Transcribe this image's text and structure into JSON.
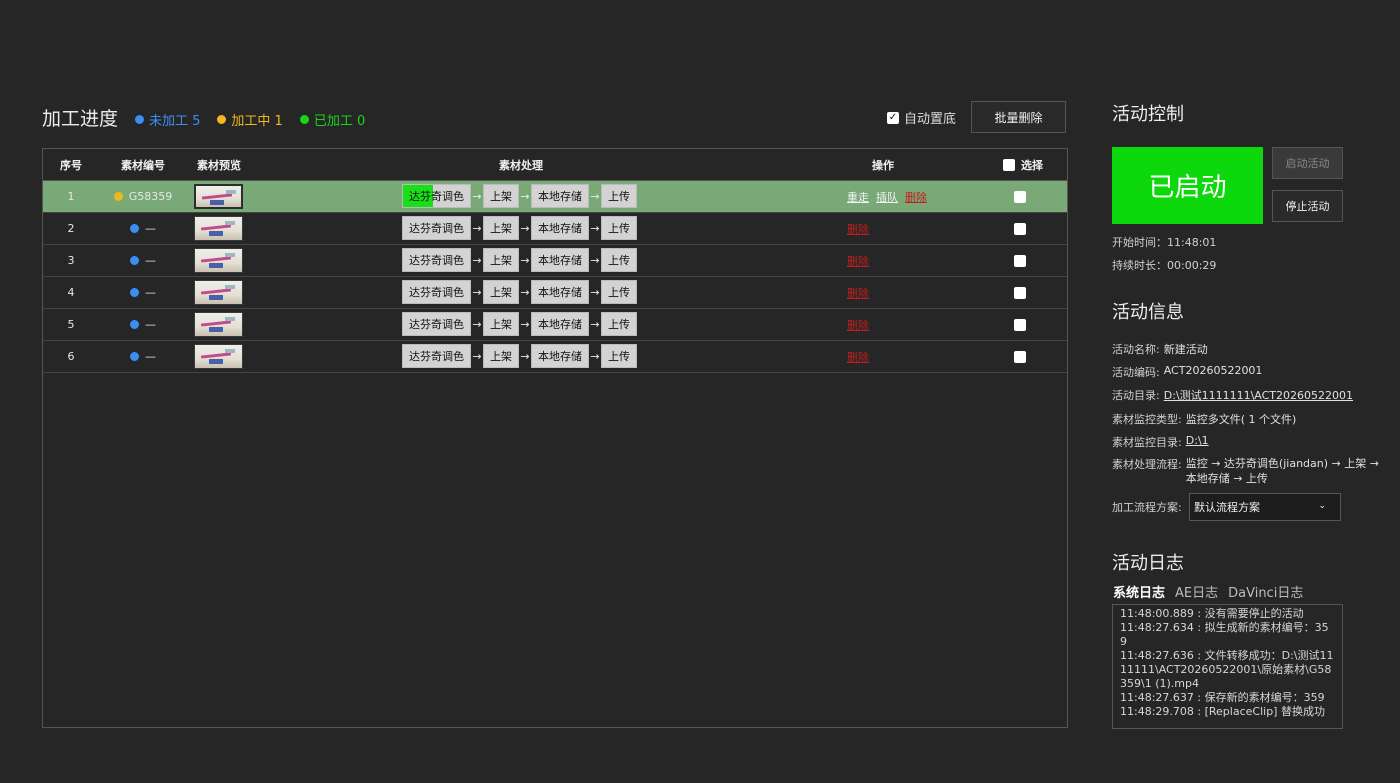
{
  "progress": {
    "title": "加工进度",
    "legend": [
      {
        "label": "未加工 5",
        "color": "#3d8ef0"
      },
      {
        "label": "加工中 1",
        "color": "#f0b81a"
      },
      {
        "label": "已加工 0",
        "color": "#1bd31b"
      }
    ],
    "auto_bottom_label": "自动置底",
    "auto_bottom_checked": true,
    "batch_delete_label": "批量删除"
  },
  "table": {
    "headers": {
      "index": "序号",
      "code": "素材编号",
      "preview": "素材预览",
      "process": "素材处理",
      "ops": "操作",
      "select": "选择"
    },
    "rows": [
      {
        "index": "1",
        "code": "G58359",
        "status_color": "#f0b81a",
        "active": true,
        "steps": [
          "达芬奇调色",
          "上架",
          "本地存储",
          "上传"
        ],
        "first_step_progress": 0.45,
        "ops": {
          "retry": "重走",
          "insert": "插队",
          "delete": "删除"
        }
      },
      {
        "index": "2",
        "code": "—",
        "status_color": "#3d8ef0",
        "active": false,
        "steps": [
          "达芬奇调色",
          "上架",
          "本地存储",
          "上传"
        ],
        "first_step_progress": 0,
        "ops": {
          "delete": "删除"
        }
      },
      {
        "index": "3",
        "code": "—",
        "status_color": "#3d8ef0",
        "active": false,
        "steps": [
          "达芬奇调色",
          "上架",
          "本地存储",
          "上传"
        ],
        "first_step_progress": 0,
        "ops": {
          "delete": "删除"
        }
      },
      {
        "index": "4",
        "code": "—",
        "status_color": "#3d8ef0",
        "active": false,
        "steps": [
          "达芬奇调色",
          "上架",
          "本地存储",
          "上传"
        ],
        "first_step_progress": 0,
        "ops": {
          "delete": "删除"
        }
      },
      {
        "index": "5",
        "code": "—",
        "status_color": "#3d8ef0",
        "active": false,
        "steps": [
          "达芬奇调色",
          "上架",
          "本地存储",
          "上传"
        ],
        "first_step_progress": 0,
        "ops": {
          "delete": "删除"
        }
      },
      {
        "index": "6",
        "code": "—",
        "status_color": "#3d8ef0",
        "active": false,
        "steps": [
          "达芬奇调色",
          "上架",
          "本地存储",
          "上传"
        ],
        "first_step_progress": 0,
        "ops": {
          "delete": "删除"
        }
      }
    ]
  },
  "control": {
    "title": "活动控制",
    "status_label": "已启动",
    "start_button": "启动活动",
    "stop_button": "停止活动",
    "start_time": "开始时间：11:48:01",
    "duration": "持续时长：00:00:29"
  },
  "info": {
    "title": "活动信息",
    "name_key": "活动名称:",
    "name_value": "新建活动",
    "code_key": "活动编码:",
    "code_value": "ACT20260522001",
    "dir_key": "活动目录:",
    "dir_value": "D:\\测试1111111\\ACT20260522001",
    "monitor_type_key": "素材监控类型:",
    "monitor_type_value": "监控多文件( 1 个文件)",
    "monitor_dir_key": "素材监控目录:",
    "monitor_dir_value": "D:\\1",
    "flow_key": "素材处理流程:",
    "flow_value": "监控 → 达芬奇调色(jiandan) → 上架 → 本地存储 → 上传",
    "scheme_key": "加工流程方案:",
    "scheme_value": "默认流程方案"
  },
  "log": {
    "title": "活动日志",
    "tabs": [
      "系统日志",
      "AE日志",
      "DaVinci日志"
    ],
    "active_tab": 0,
    "lines": [
      "11:48:00.889 : 没有需要停止的活动",
      "11:48:27.634 : 拟生成新的素材编号：359",
      "11:48:27.636 : 文件转移成功：D:\\测试1111111\\ACT20260522001\\原始素材\\G58359\\1 (1).mp4",
      "11:48:27.637 : 保存新的素材编号：359",
      "11:48:29.708 : [ReplaceClip] 替换成功"
    ]
  }
}
